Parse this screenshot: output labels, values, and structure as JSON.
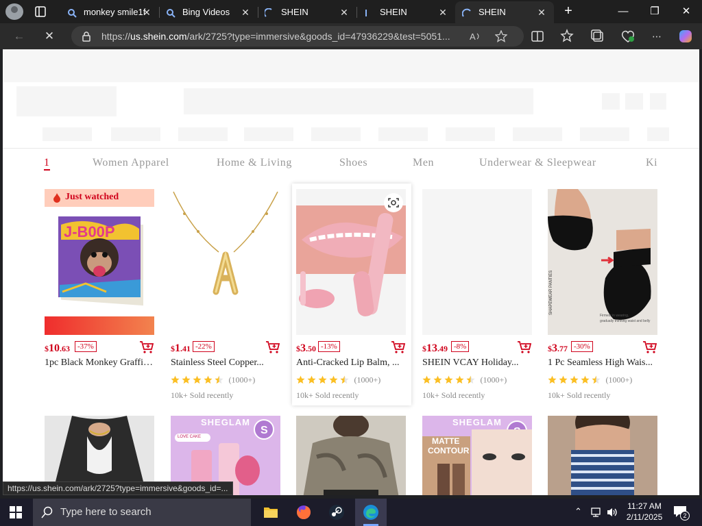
{
  "browser": {
    "tabs": [
      {
        "title": "monkey smile1f",
        "icon": "bing-search-icon"
      },
      {
        "title": "Bing Videos",
        "icon": "bing-search-icon"
      },
      {
        "title": "SHEIN",
        "icon": "loading-icon"
      },
      {
        "title": "SHEIN",
        "icon": "loading-icon"
      },
      {
        "title": "SHEIN",
        "icon": "loading-icon",
        "active": true
      }
    ],
    "url_prefix": "https://",
    "url_host": "us.shein.com",
    "url_path": "/ark/2725?type=immersive&goods_id=47936229&test=5051..."
  },
  "categories": [
    "1",
    "Women Apparel",
    "Home & Living",
    "Shoes",
    "Men",
    "Underwear & Sleepwear",
    "Ki"
  ],
  "products": [
    {
      "currency": "$",
      "price_int": "10",
      "price_dec": ".63",
      "discount": "-37%",
      "name": "1pc Black Monkey Graffiti...",
      "badge": "Just watched",
      "has_rating": false
    },
    {
      "currency": "$",
      "price_int": "1",
      "price_dec": ".41",
      "discount": "-22%",
      "name": "Stainless Steel Copper...",
      "rating_count": "(1000+)",
      "sold": "10k+ Sold recently",
      "has_rating": true
    },
    {
      "currency": "$",
      "price_int": "3",
      "price_dec": ".50",
      "discount": "-13%",
      "name": "Anti-Cracked Lip Balm, ...",
      "rating_count": "(1000+)",
      "sold": "10k+ Sold recently",
      "has_rating": true
    },
    {
      "currency": "$",
      "price_int": "13",
      "price_dec": ".49",
      "discount": "-8%",
      "name": "SHEIN VCAY Holiday...",
      "rating_count": "(1000+)",
      "sold": "10k+ Sold recently",
      "has_rating": true
    },
    {
      "currency": "$",
      "price_int": "3",
      "price_dec": ".77",
      "discount": "-30%",
      "name": "1 Pc Seamless High Wais...",
      "rating_count": "(1000+)",
      "sold": "10k+ Sold recently",
      "has_rating": true
    }
  ],
  "row2_labels": {
    "sheglam": "SHEGLAM",
    "love_cake": "LOVE CAKE",
    "matte": "MATTE",
    "contour": "CONTOUR"
  },
  "status_url": "https://us.shein.com/ark/2725?type=immersive&goods_id=...",
  "taskbar": {
    "search_placeholder": "Type here to search",
    "time": "11:27 AM",
    "date": "2/11/2025",
    "notifications": "2"
  },
  "colors": {
    "accent": "#d0021b",
    "star": "#fbbf24"
  }
}
